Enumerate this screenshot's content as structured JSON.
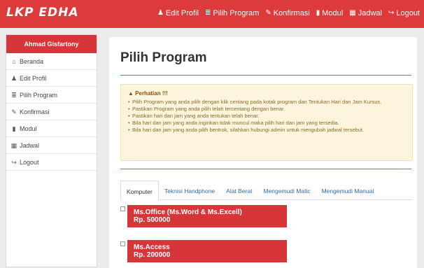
{
  "app": {
    "brand": "LKP EDHA"
  },
  "topnav": [
    {
      "icon": "user-icon",
      "glyph": "♟",
      "label": "Edit Profil"
    },
    {
      "icon": "list-icon",
      "glyph": "≣",
      "label": "Pilih Program"
    },
    {
      "icon": "tag-icon",
      "glyph": "✎",
      "label": "Konfirmasi"
    },
    {
      "icon": "book-icon",
      "glyph": "▮",
      "label": "Modul"
    },
    {
      "icon": "calendar-icon",
      "glyph": "▦",
      "label": "Jadwal"
    },
    {
      "icon": "logout-icon",
      "glyph": "↪",
      "label": "Logout"
    }
  ],
  "sidebar": {
    "user_name": "Ahmad Gisfartony",
    "items": [
      {
        "icon": "home-icon",
        "glyph": "⌂",
        "label": "Beranda"
      },
      {
        "icon": "user-icon",
        "glyph": "♟",
        "label": "Edit Profil"
      },
      {
        "icon": "list-icon",
        "glyph": "≣",
        "label": "Pilih Program"
      },
      {
        "icon": "tag-icon",
        "glyph": "✎",
        "label": "Konfirmasi"
      },
      {
        "icon": "book-icon",
        "glyph": "▮",
        "label": "Modul"
      },
      {
        "icon": "calendar-icon",
        "glyph": "▦",
        "label": "Jadwal"
      },
      {
        "icon": "logout-icon",
        "glyph": "↪",
        "label": "Logout"
      }
    ]
  },
  "main": {
    "title": "Pilih Program",
    "alert": {
      "heading": "Perhatian !!!",
      "icon": "warning-icon",
      "items": [
        "Pilih Program yang anda pilih dengan klik centang pada kotak program dan Tentukan Hari dan Jam Kursus.",
        "Pastikan Program yang anda pilih telah tercentang dengan benar.",
        "Pastikan hari dan jam yang anda tentukan telah benar.",
        "Bila hari dan jam yang anda inginkan tidak muncul maka pilih hari dan jam yang tersedia.",
        "Bila hari dan jam yang anda pilih bentrok, silahkan hubungi admin untuk mengubah jadwal tersebut."
      ]
    },
    "tabs": [
      {
        "label": "Komputer",
        "active": true
      },
      {
        "label": "Teknisi Handphone",
        "active": false
      },
      {
        "label": "Alat Berat",
        "active": false
      },
      {
        "label": "Mengemudi Matic",
        "active": false
      },
      {
        "label": "Mengemudi Manual",
        "active": false
      }
    ],
    "programs": [
      {
        "name": "Ms.Office (Ms.Word & Ms.Excell)",
        "price": "Rp. 500000"
      },
      {
        "name": "Ms.Access",
        "price": "Rp. 200000"
      }
    ]
  },
  "colors": {
    "primary": "#dd3b3b",
    "alert_bg": "#fcf4dd",
    "link": "#2d69b7"
  }
}
